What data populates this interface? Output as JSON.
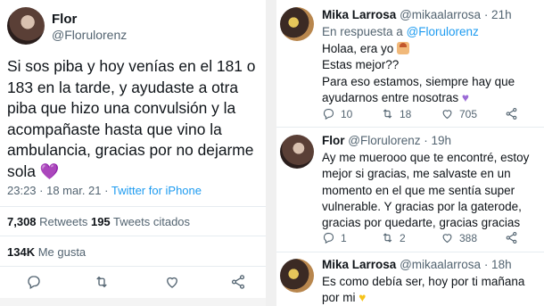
{
  "main_tweet": {
    "author_name": "Flor",
    "author_handle": "@Florulorenz",
    "text": "Si sos piba y hoy venías en el 181 o 183 en la tarde, y ayudaste a otra piba que hizo una convulsión y la acompañaste hasta que vino la ambulancia, gracias por no dejarme sola 💜",
    "time": "23:23 · 18 mar. 21 · ",
    "source": "Twitter for iPhone",
    "retweets_count": "7,308",
    "retweets_label": " Retweets  ",
    "quotes_count": "195",
    "quotes_label": " Tweets citados",
    "likes_count": "134K",
    "likes_label": " Me gusta",
    "actions": [
      "reply-icon",
      "retweet-icon",
      "like-icon",
      "share-icon"
    ]
  },
  "replies": [
    {
      "author_name": "Mika Larrosa",
      "author_handle": "@mikaalarrosa",
      "time": "· 21h",
      "reply_prefix": "En respuesta a ",
      "reply_to": "@Florulorenz",
      "text_lines": [
        "Holaa, era yo",
        "Estas mejor??",
        "Para eso estamos, siempre hay que ayudarnos entre nosotras"
      ],
      "reply_count": "10",
      "retweet_count": "18",
      "like_count": "705"
    },
    {
      "author_name": "Flor",
      "author_handle": "@Florulorenz",
      "time": "· 19h",
      "text": "Ay me muerooo que te encontré, estoy mejor si gracias, me salvaste en un momento en el que me sentía super vulnerable. Y gracias por la gaterode, gracias por quedarte, gracias gracias",
      "reply_count": "1",
      "retweet_count": "2",
      "like_count": "388"
    },
    {
      "author_name": "Mika Larrosa",
      "author_handle": "@mikaalarrosa",
      "time": "· 18h",
      "text": "Es como debía ser, hoy por ti mañana por mi"
    }
  ],
  "colors": {
    "accent": "#1d9bf0",
    "muted": "#536471",
    "text": "#0f1419"
  }
}
